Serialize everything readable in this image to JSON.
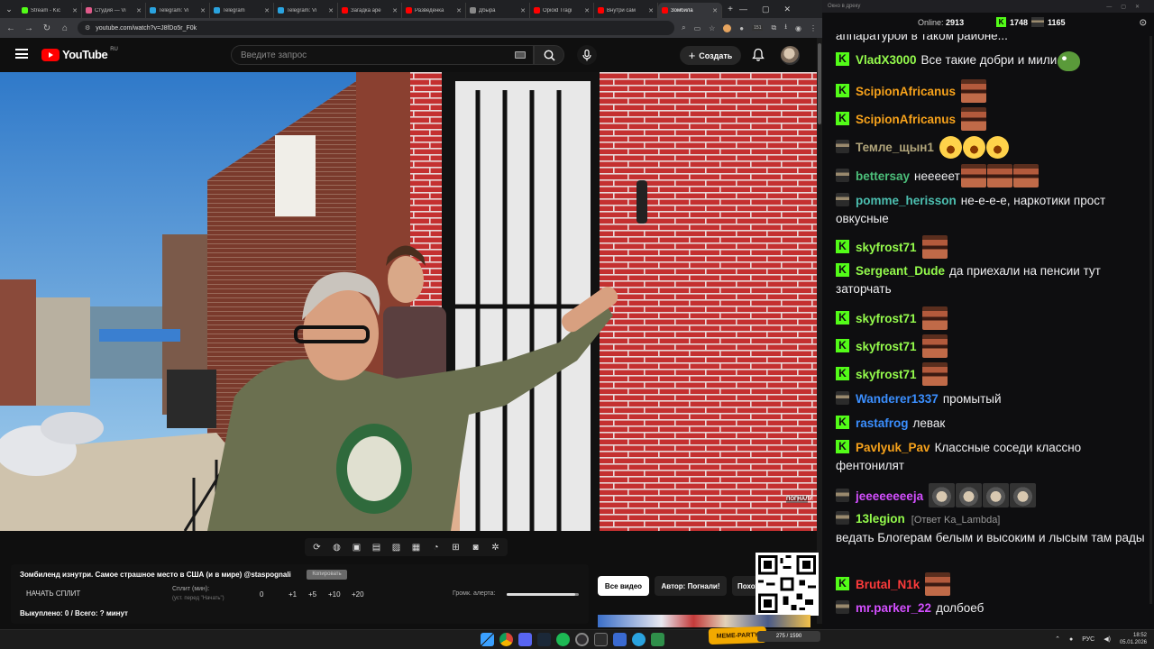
{
  "browser": {
    "tabs": [
      {
        "title": "Stream - Kic",
        "color": "#53fc18",
        "active": false
      },
      {
        "title": "Студия — Vi",
        "color": "#e05a8a",
        "active": false
      },
      {
        "title": "Telegram: Vi",
        "color": "#2aa3df",
        "active": false
      },
      {
        "title": "Telegram",
        "color": "#2aa3df",
        "active": false
      },
      {
        "title": "Telegram: Vi",
        "color": "#2aa3df",
        "active": false
      },
      {
        "title": "Загадка аре",
        "color": "#ff0000",
        "active": false
      },
      {
        "title": "Разведенка",
        "color": "#ff0000",
        "active": false
      },
      {
        "title": "Дбыра",
        "color": "#888888",
        "active": false
      },
      {
        "title": "Opioid Tragi",
        "color": "#ff0000",
        "active": false
      },
      {
        "title": "Внутри сам",
        "color": "#ff0000",
        "active": false
      },
      {
        "title": "Зомбила",
        "color": "#ff0000",
        "active": true
      }
    ],
    "url": "youtube.com/watch?v=J8fDo5r_F0k",
    "ext_badge": "151"
  },
  "youtube": {
    "logo_text": "YouTube",
    "country_code": "RU",
    "search_placeholder": "Введите запрос",
    "create_label": "Создать"
  },
  "video_panel": {
    "title": "Зомбиленд изнутри. Самое страшное место в США (и в мире) @staspognali",
    "copy_label": "Копировать",
    "start_split": "НАЧАТЬ СПЛИТ",
    "split_label": "Сплит (мин):",
    "split_sub": "(уст. перед \"Начать\")",
    "split_value": "0",
    "split_steps": [
      "+1",
      "+5",
      "+10",
      "+20"
    ],
    "alert_volume_label": "Громк. алерта:",
    "alert_volume": 0.95,
    "bought": "Выкуплено: 0 / Всего: ? минут",
    "watermark": "ПОГНАЛИ"
  },
  "pills": {
    "all_videos": "Все видео",
    "author": "Автор: Погнали!",
    "similar": "Похожие"
  },
  "chat": {
    "window_title": "Окно в дреку",
    "online_label": "Online:",
    "online_count": "2913",
    "kick_count": "1748",
    "glasses_count": "1165",
    "messages": [
      {
        "badge": "none",
        "user": "",
        "color": "#ffffff",
        "text": "аппаратурой в таком районе...",
        "emotes": []
      },
      {
        "badge": "kick",
        "user": "VladX3000",
        "color": "#94fb4c",
        "text": "Все такие добри и мили",
        "emotes": [
          "pepe"
        ]
      },
      {
        "badge": "kick",
        "user": "ScipionAfricanus",
        "color": "#f7a21b",
        "text": "",
        "emotes": [
          "face"
        ]
      },
      {
        "badge": "kick",
        "user": "ScipionAfricanus",
        "color": "#f7a21b",
        "text": "",
        "emotes": [
          "face"
        ]
      },
      {
        "badge": "glasses",
        "user": "Темле_щын1",
        "color": "#b0a47a",
        "text": "",
        "emotes": [
          "laugh",
          "laugh",
          "laugh"
        ]
      },
      {
        "badge": "glasses",
        "user": "bettersay",
        "color": "#4cbf7a",
        "text": "неееeет",
        "emotes": [
          "face",
          "face",
          "face"
        ]
      },
      {
        "badge": "glasses",
        "user": "pomme_herisson",
        "color": "#4cbfb0",
        "text": "не-е-е-е, наркотики прост овкусные",
        "emotes": []
      },
      {
        "badge": "kick",
        "user": "skyfrost71",
        "color": "#94fb4c",
        "text": "",
        "emotes": [
          "face"
        ]
      },
      {
        "badge": "kick",
        "user": "Sergeant_Dude",
        "color": "#94fb4c",
        "text": "да приехали на пенсии тут заторчать",
        "emotes": []
      },
      {
        "badge": "kick",
        "user": "skyfrost71",
        "color": "#94fb4c",
        "text": "",
        "emotes": [
          "face"
        ]
      },
      {
        "badge": "kick",
        "user": "skyfrost71",
        "color": "#94fb4c",
        "text": "",
        "emotes": [
          "face"
        ]
      },
      {
        "badge": "kick",
        "user": "skyfrost71",
        "color": "#94fb4c",
        "text": "",
        "emotes": [
          "face"
        ]
      },
      {
        "badge": "glasses",
        "user": "Wanderer1337",
        "color": "#3b8fff",
        "text": "промытый",
        "emotes": []
      },
      {
        "badge": "kick",
        "user": "rastafrog",
        "color": "#3b8fff",
        "text": "левак",
        "emotes": []
      },
      {
        "badge": "kick",
        "user": "Pavlyuk_Pav",
        "color": "#f7a21b",
        "text": "Классные соседи классно фентонилят",
        "emotes": []
      },
      {
        "badge": "glasses",
        "user": "jeeeeeeeeja",
        "color": "#d34fff",
        "text": "",
        "emotes": [
          "gray",
          "gray",
          "gray",
          "gray"
        ]
      },
      {
        "badge": "glasses",
        "user": "13legion",
        "color": "#94fb4c",
        "reply": "[Ответ Ka_Lambda]",
        "text": "ведать Блогерам белым и высоким и лысым там рады",
        "emotes": []
      },
      {
        "badge": "kick",
        "user": "Brutal_N1k",
        "color": "#ff3b3b",
        "text": "",
        "emotes": [
          "face"
        ]
      },
      {
        "badge": "glasses",
        "user": "mr.parker_22",
        "color": "#d34fff",
        "text": "долбоеб",
        "emotes": []
      }
    ]
  },
  "taskbar": {
    "stream_label": "275 / 1590",
    "lang": "РУС",
    "time": "18:52",
    "date": "05.01.2026",
    "kk_label": "MEME-PARTY"
  }
}
